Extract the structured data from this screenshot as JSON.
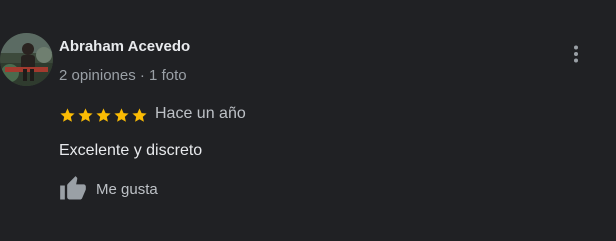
{
  "review": {
    "author_name": "Abraham Acevedo",
    "author_meta": "2 opiniones · 1 foto",
    "rating": 5,
    "rating_max": 5,
    "date": "Hace un año",
    "text": "Excelente y discreto",
    "like_label": "Me gusta"
  },
  "icons": {
    "menu": "more-vertical-icon",
    "star": "star-icon",
    "like": "thumb-up-icon"
  },
  "colors": {
    "background": "#202124",
    "star": "#fbbc04",
    "name": "#e8eaed",
    "secondary_text": "#9aa0a6",
    "icon": "#9aa0a6"
  }
}
